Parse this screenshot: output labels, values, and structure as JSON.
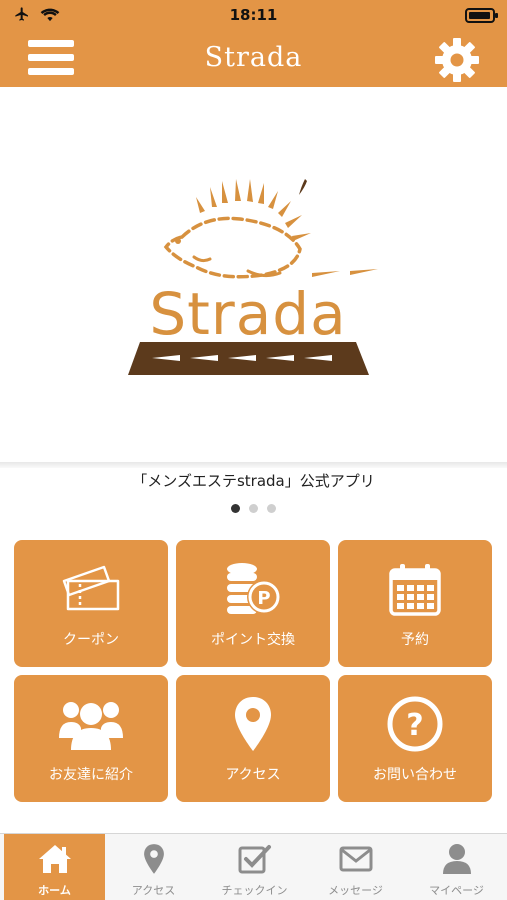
{
  "status_bar": {
    "time": "18:11",
    "icons": [
      "airplane-icon",
      "wifi-icon",
      "battery-icon"
    ],
    "battery_level": 0.95
  },
  "nav": {
    "title": "Strada",
    "menu_icon": "hamburger-menu-icon",
    "settings_icon": "gear-icon"
  },
  "banner": {
    "logo_text": "Strada",
    "caption": "「メンズエステstrada」公式アプリ",
    "page_count": 3,
    "active_page": 1
  },
  "grid": {
    "tiles": [
      {
        "label": "クーポン",
        "icon": "ticket-icon"
      },
      {
        "label": "ポイント交換",
        "icon": "coins-icon"
      },
      {
        "label": "予約",
        "icon": "calendar-icon"
      },
      {
        "label": "お友達に紹介",
        "icon": "users-icon"
      },
      {
        "label": "アクセス",
        "icon": "map-pin-icon"
      },
      {
        "label": "お問い合わせ",
        "icon": "question-icon"
      }
    ]
  },
  "tabbar": {
    "tabs": [
      {
        "label": "ホーム",
        "icon": "home-icon",
        "active": true
      },
      {
        "label": "アクセス",
        "icon": "map-pin-icon",
        "active": false
      },
      {
        "label": "チェックイン",
        "icon": "checkin-icon",
        "active": false
      },
      {
        "label": "メッセージ",
        "icon": "envelope-icon",
        "active": false
      },
      {
        "label": "マイページ",
        "icon": "user-icon",
        "active": false
      }
    ]
  },
  "colors": {
    "accent": "#e39546",
    "logo_brown": "#5c3a1c",
    "logo_orange": "#d7913f"
  }
}
